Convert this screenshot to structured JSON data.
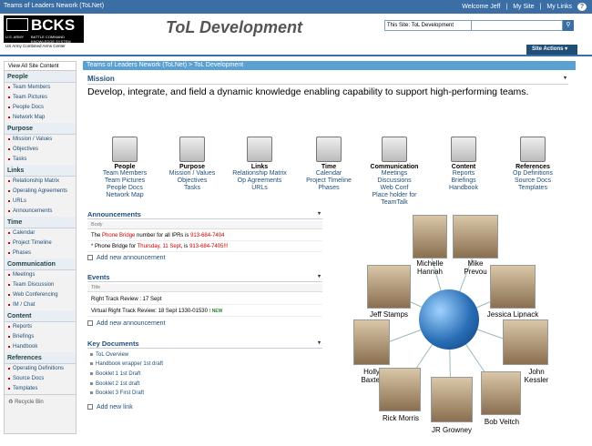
{
  "topbar": {
    "site_name": "Teams of Leaders Nework (ToLNet)",
    "welcome": "Welcome Jeff",
    "my_site": "My Site",
    "my_links": "My Links",
    "help": "?"
  },
  "header": {
    "logo_text": "BCKS",
    "logo_army": "U.S. ARMY",
    "logo_sub": "BATTLE COMMAND KNOWLEDGE SYSTEM",
    "logo_caption": "US Army Combined Arms Center",
    "page_title": "ToL Development",
    "search_scope": "This Site: ToL Development",
    "site_actions": "Site Actions"
  },
  "breadcrumb": "Teams of Leaders Nework (ToLNet) > ToL Development",
  "leftnav": {
    "view_all": "View All Site Content",
    "sections": [
      {
        "title": "People",
        "items": [
          "Team Members",
          "Team Pictures",
          "People Docs",
          "Network Map"
        ]
      },
      {
        "title": "Purpose",
        "items": [
          "Mission / Values",
          "Objectives",
          "Tasks"
        ]
      },
      {
        "title": "Links",
        "items": [
          "Relationship Matrix",
          "Operating Agreements",
          "URLs",
          "Announcements"
        ]
      },
      {
        "title": "Time",
        "items": [
          "Calendar",
          "Project Timeline",
          "Phases"
        ]
      },
      {
        "title": "Communication",
        "items": [
          "Meetings",
          "Team Discussion",
          "Web Conferencing",
          "IM / Chat"
        ]
      },
      {
        "title": "Content",
        "items": [
          "Reports",
          "Briefings",
          "Handbook"
        ]
      },
      {
        "title": "References",
        "items": [
          "Operating Definitions",
          "Source Docs",
          "Templates"
        ]
      }
    ],
    "recycle_bin": "Recycle Bin"
  },
  "mission": {
    "heading": "Mission",
    "text": "Develop, integrate, and field a dynamic knowledge enabling capability to support high-performing teams."
  },
  "categories": [
    {
      "label": "People",
      "links": [
        "Team Members",
        "Team Pictures",
        "People Docs",
        "Network Map"
      ],
      "icon": "people-icon"
    },
    {
      "label": "Purpose",
      "links": [
        "Mission / Values",
        "Objectives",
        "Tasks"
      ],
      "icon": "purpose-icon"
    },
    {
      "label": "Links",
      "links": [
        "Relationship Matrix",
        "Op Agreements",
        "URLs"
      ],
      "icon": "links-icon"
    },
    {
      "label": "Time",
      "links": [
        "Calendar",
        "Project Timeline",
        "Phases"
      ],
      "icon": "time-icon"
    },
    {
      "label": "Communication",
      "links": [
        "Meetings",
        "Discussions",
        "Web Conf",
        "Place holder for",
        "TeamTalk"
      ],
      "icon": "communication-icon"
    },
    {
      "label": "Content",
      "links": [
        "Reports",
        "Briefings",
        "Handbook"
      ],
      "icon": "content-icon"
    },
    {
      "label": "References",
      "links": [
        "Op Definitions",
        "Source Docs",
        "Templates"
      ],
      "icon": "references-icon"
    }
  ],
  "announcements": {
    "heading": "Announcements",
    "column": "Body",
    "row1_a": "The ",
    "row1_b": "Phone Bridge",
    "row1_c": " number for all IPRs is ",
    "row1_d": "913-684-7404",
    "row2_a": "* Phone Bridge for ",
    "row2_b": "Thursday, 11 Sept",
    "row2_c": ", is ",
    "row2_d": "913-684-7405!!!",
    "add": "Add new announcement"
  },
  "events": {
    "heading": "Events",
    "column": "Title",
    "row1": "Right Track Review : 17 Sept",
    "row2": "Virtual Right Track Review: 18 Sept 1330-01530",
    "row2_new": "! NEW",
    "add": "Add new announcement"
  },
  "key_documents": {
    "heading": "Key Documents",
    "items": [
      "ToL Overview",
      "Handbook wrapper 1st draft",
      "Booklet 1 1st Draft",
      "Booklet 2 1st draft",
      "Booklet 3 First Draft"
    ],
    "add": "Add new link"
  },
  "team": {
    "members": [
      {
        "first": "Michelle",
        "last": "Hannah"
      },
      {
        "first": "Mike",
        "last": "Prevou"
      },
      {
        "first": "Jeff Stamps",
        "last": ""
      },
      {
        "first": "Jessica Lipnack",
        "last": ""
      },
      {
        "first": "Holly",
        "last": "Baxter"
      },
      {
        "first": "John",
        "last": "Kessler"
      },
      {
        "first": "Rick Morris",
        "last": ""
      },
      {
        "first": "JR Growney",
        "last": ""
      },
      {
        "first": "Bob Veitch",
        "last": ""
      }
    ]
  }
}
